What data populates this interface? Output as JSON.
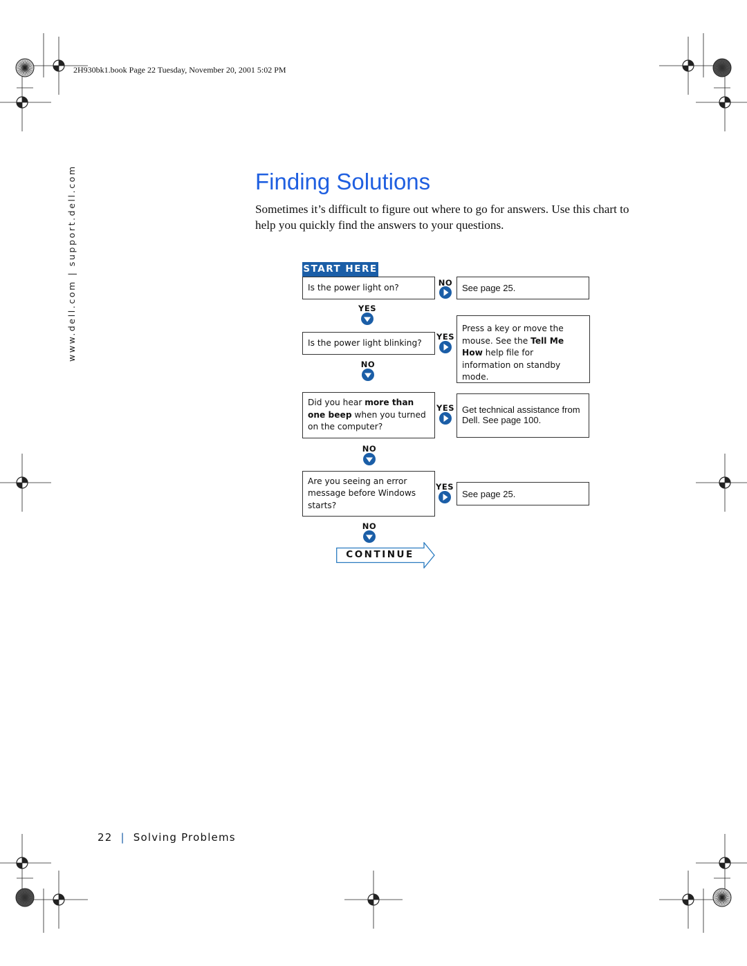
{
  "header": {
    "print_info": "2H930bk1.book  Page 22  Tuesday, November 20, 2001  5:02 PM"
  },
  "sidebar": {
    "text": "www.dell.com | support.dell.com"
  },
  "page": {
    "title": "Finding Solutions",
    "intro": "Sometimes it’s difficult to figure out where to go for answers. Use this chart to help you quickly find the answers to your questions."
  },
  "flowchart": {
    "start_label": "START HERE",
    "accent_color": "#1b5ea7",
    "q1": {
      "text": "Is the power light on?",
      "no_label": "NO",
      "answer": "See page 25.",
      "yes_label": "YES"
    },
    "q2": {
      "text": "Is the power light blinking?",
      "yes_label": "YES",
      "answer_pre": "Press a key or move the mouse. See the ",
      "answer_bold": "Tell Me How",
      "answer_post": " help file for information on standby mode.",
      "no_label": "NO"
    },
    "q3": {
      "text_pre": "Did you hear ",
      "text_bold1": "more than one beep",
      "text_post": " when you turned on the computer?",
      "yes_label": "YES",
      "answer": "Get technical assistance from Dell. See page 100.",
      "no_label": "NO"
    },
    "q4": {
      "text": "Are you seeing an error message before Windows starts?",
      "yes_label": "YES",
      "answer": "See page 25.",
      "no_label": "NO"
    },
    "continue_label": "CONTINUE"
  },
  "footer": {
    "page_number": "22",
    "separator": "|",
    "section": "Solving Problems"
  }
}
